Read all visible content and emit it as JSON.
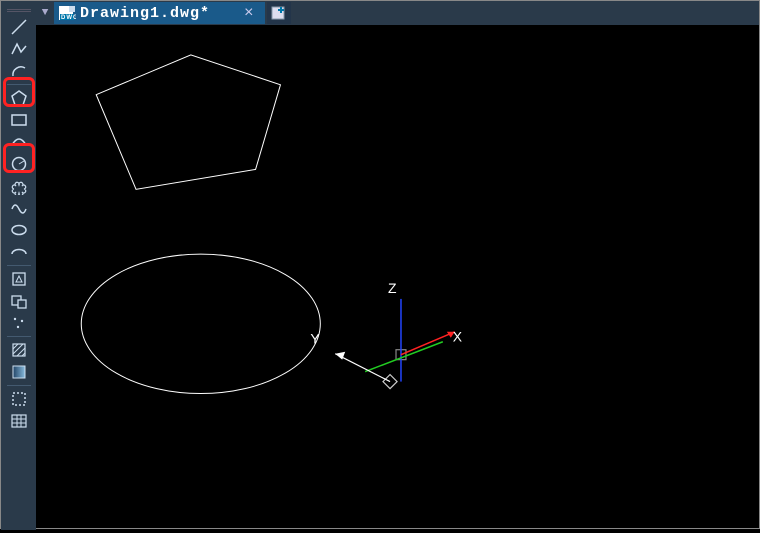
{
  "tab": {
    "filename": "Drawing1.dwg*",
    "close_glyph": "×",
    "new_tab_glyph": "+",
    "menu_glyph": "▼"
  },
  "window_controls": {
    "minimize": "—",
    "restore": "❐",
    "close": "✕"
  },
  "tools": [
    {
      "id": "line",
      "name": "line-tool"
    },
    {
      "id": "polyline",
      "name": "polyline-tool"
    },
    {
      "id": "arc",
      "name": "arc-tool"
    },
    {
      "id": "sep"
    },
    {
      "id": "polygon",
      "name": "polygon-tool",
      "highlighted": true
    },
    {
      "id": "rectangle",
      "name": "rectangle-tool"
    },
    {
      "id": "arc3pt",
      "name": "arc-3pt-tool"
    },
    {
      "id": "circle",
      "name": "circle-tool",
      "highlighted": true
    },
    {
      "id": "revcloud",
      "name": "revision-cloud-tool"
    },
    {
      "id": "spline",
      "name": "spline-tool"
    },
    {
      "id": "ellipse",
      "name": "ellipse-tool"
    },
    {
      "id": "ellipsearc",
      "name": "ellipse-arc-tool"
    },
    {
      "id": "sep"
    },
    {
      "id": "block",
      "name": "insert-block-tool"
    },
    {
      "id": "makeblock",
      "name": "make-block-tool"
    },
    {
      "id": "point",
      "name": "point-tool"
    },
    {
      "id": "sep"
    },
    {
      "id": "hatch",
      "name": "hatch-tool"
    },
    {
      "id": "gradient",
      "name": "gradient-tool"
    },
    {
      "id": "sep"
    },
    {
      "id": "region",
      "name": "region-tool"
    },
    {
      "id": "table",
      "name": "table-tool"
    }
  ],
  "axes": {
    "x_label": "X",
    "y_label": "Y",
    "z_label": "Z"
  },
  "canvas_shapes": {
    "pentagon": "drawn white pentagon outline",
    "ellipse": "drawn white ellipse outline"
  }
}
